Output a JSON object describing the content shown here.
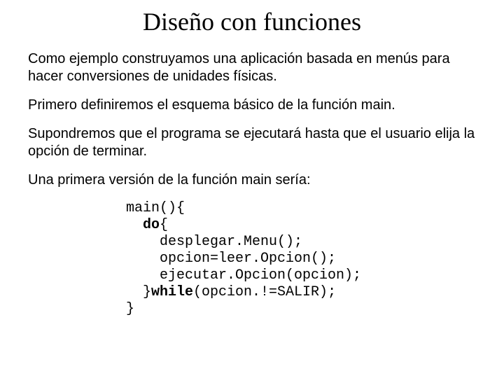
{
  "title": "Diseño con funciones",
  "paragraphs": {
    "p1": "Como ejemplo construyamos una aplicación basada en menús para hacer conversiones de unidades físicas.",
    "p2": "Primero definiremos el esquema básico de la función main.",
    "p3": "Supondremos que el programa se ejecutará hasta que el usuario elija la opción de terminar.",
    "p4": "Una primera versión de la función main sería:"
  },
  "code": {
    "l1": "main(){",
    "l2a": "  ",
    "l2b": "do",
    "l2c": "{",
    "l3": "    desplegar.Menu();",
    "l4": "    opcion=leer.Opcion();",
    "l5": "    ejecutar.Opcion(opcion);",
    "l6a": "  }",
    "l6b": "while",
    "l6c": "(opcion.!=SALIR);",
    "l7": "}"
  }
}
